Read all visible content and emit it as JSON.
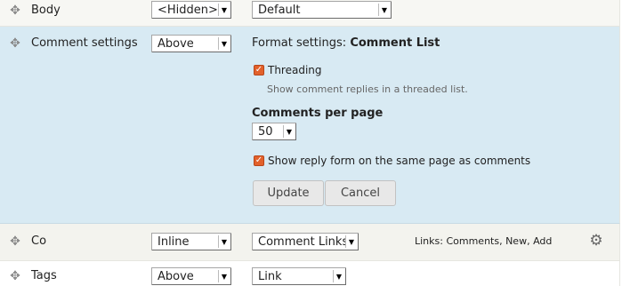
{
  "rows": {
    "body": {
      "label": "Body",
      "label_select": "<Hidden>",
      "format_select": "Default"
    },
    "comment": {
      "label": "Comment settings",
      "label_select": "Above",
      "format_settings_prefix": "Format settings:",
      "format_settings_name": "Comment List",
      "threading_label": "Threading",
      "threading_checked": true,
      "threading_description": "Show comment replies in a threaded list.",
      "per_page_label": "Comments per page",
      "per_page_value": "50",
      "reply_form_label": "Show reply form on the same page as comments",
      "reply_form_checked": true,
      "update_button": "Update",
      "cancel_button": "Cancel"
    },
    "co": {
      "label": "Co",
      "label_select": "Inline",
      "format_select": "Comment Links",
      "summary": "Links: Comments, New, Add"
    },
    "tags": {
      "label": "Tags",
      "label_select": "Above",
      "format_select": "Link"
    }
  },
  "icons": {
    "drag": "drag-handle-icon",
    "gear": "gear-icon",
    "check": "checkmark-icon",
    "select_arrow": "chevron-down-icon"
  },
  "colors": {
    "active_row": "#d8eaf3",
    "checkbox": "#e2612b"
  }
}
